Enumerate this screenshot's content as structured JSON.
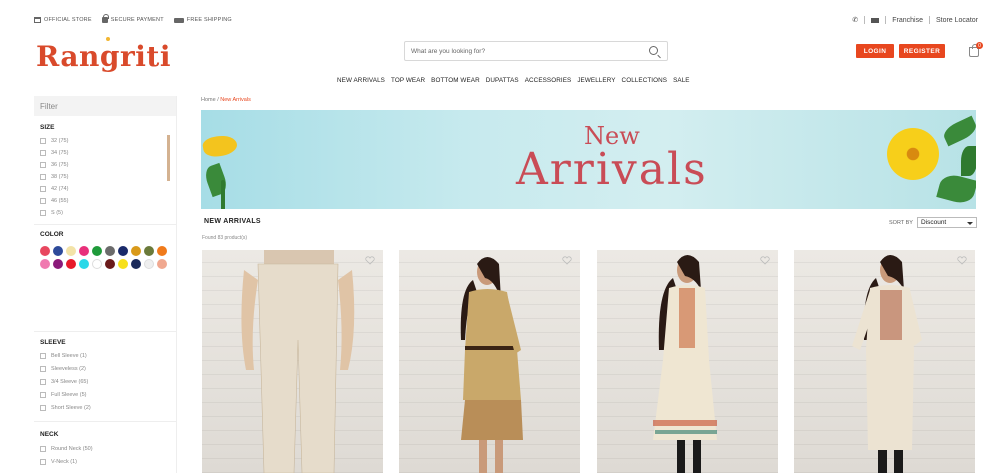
{
  "top_strip": {
    "official_store": "OFFICIAL STORE",
    "secure_payment": "SECURE PAYMENT",
    "free_shipping": "FREE SHIPPING",
    "franchise": "Franchise",
    "store_locator": "Store Locator"
  },
  "header": {
    "logo_text": "Rangriti",
    "search_placeholder": "What are you looking for?",
    "login_label": "LOGIN",
    "register_label": "REGISTER",
    "cart_count": "0"
  },
  "nav": {
    "items": [
      "NEW ARRIVALS",
      "TOP WEAR",
      "BOTTOM WEAR",
      "DUPATTAS",
      "ACCESSORIES",
      "JEWELLERY",
      "COLLECTIONS",
      "SALE"
    ]
  },
  "filter": {
    "title": "Filter",
    "size": {
      "title": "SIZE",
      "options": [
        "32 (75)",
        "34 (75)",
        "36 (75)",
        "38 (75)",
        "42 (74)",
        "46 (55)",
        "S (5)"
      ]
    },
    "color": {
      "title": "COLOR",
      "swatches": [
        "#e8475f",
        "#2d4a9a",
        "#f3e3a8",
        "#e8307a",
        "#1f9a3a",
        "#6b6b6b",
        "#1a2a6a",
        "#d99a1a",
        "#6a7a3a",
        "#f07a1a",
        "#f07ab0",
        "#8a1a7a",
        "#e81a2a",
        "#2ad8e8",
        "#ffffff",
        "#6a1a1a",
        "#f7e01a",
        "#1a2a5a",
        "#efefef",
        "#f0a890"
      ]
    },
    "sleeve": {
      "title": "SLEEVE",
      "options": [
        "Bell Sleeve (1)",
        "Sleeveless (2)",
        "3/4 Sleeve (65)",
        "Full Sleeve (5)",
        "Short Sleeve (2)"
      ]
    },
    "neck": {
      "title": "NECK",
      "options": [
        "Round Neck (50)",
        "V-Neck (1)"
      ]
    }
  },
  "main": {
    "breadcrumb_home": "Home",
    "breadcrumb_sep": " / ",
    "breadcrumb_current": "New Arrivals",
    "banner_line1": "New",
    "banner_line2": "Arrivals",
    "section_title": "NEW ARRIVALS",
    "found_text": "Found 83 product(s)",
    "sort_label": "SORT BY",
    "sort_value": "Discount"
  },
  "icons": {
    "store": "store-icon",
    "lock": "lock-icon",
    "truck": "truck-icon",
    "phone": "phone-icon",
    "mail": "mail-icon",
    "search": "search-icon",
    "bag": "shopping-bag-icon",
    "heart": "heart-icon"
  },
  "colors": {
    "brand": "#d94a2b",
    "button": "#e8471f"
  }
}
